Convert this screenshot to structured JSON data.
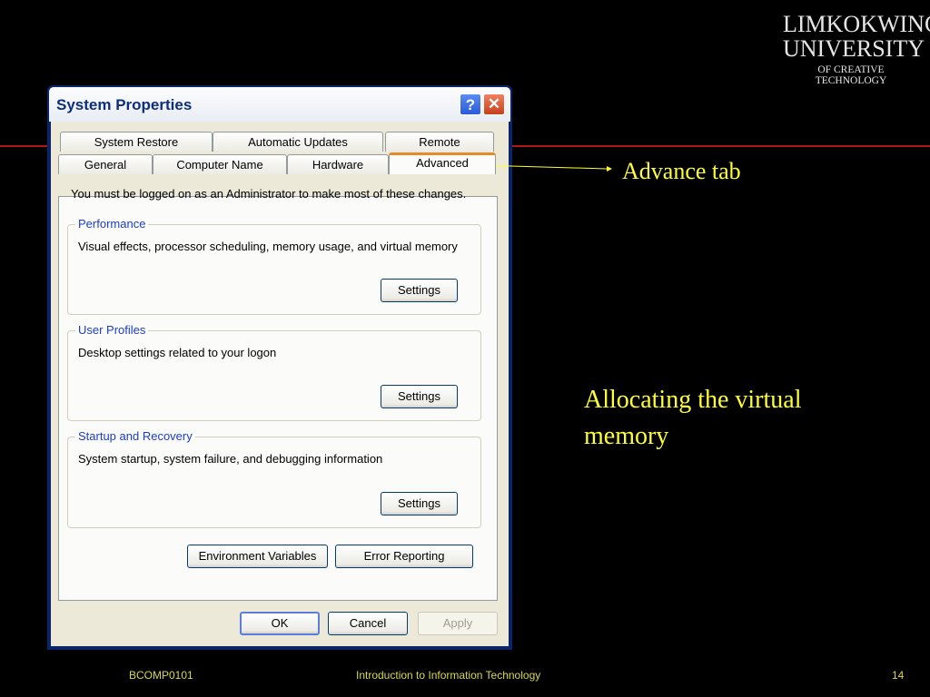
{
  "logo": {
    "line1": "LIMKOKWING",
    "line2": "UNIVERSITY",
    "line3": "OF CREATIVE TECHNOLOGY"
  },
  "dialog": {
    "title": "System Properties",
    "help_glyph": "?",
    "close_glyph": "✕",
    "tabs_row1": [
      "System Restore",
      "Automatic Updates",
      "Remote"
    ],
    "tabs_row2": [
      "General",
      "Computer Name",
      "Hardware",
      "Advanced"
    ],
    "active_tab": "Advanced",
    "note": "You must be logged on as an Administrator to make most of these changes.",
    "groups": [
      {
        "title": "Performance",
        "description": "Visual effects, processor scheduling, memory usage, and virtual memory",
        "button": "Settings"
      },
      {
        "title": "User Profiles",
        "description": "Desktop settings related to your logon",
        "button": "Settings"
      },
      {
        "title": "Startup and Recovery",
        "description": "System startup, system failure, and debugging information",
        "button": "Settings"
      }
    ],
    "env_button": "Environment Variables",
    "error_button": "Error Reporting",
    "ok_button": "OK",
    "cancel_button": "Cancel",
    "apply_button": "Apply"
  },
  "annotations": {
    "advance_tab": "Advance tab",
    "allocating": "Allocating the virtual memory"
  },
  "footer": {
    "course_code": "BCOMP0101",
    "course_title": "Introduction to Information Technology",
    "page_number": "14"
  },
  "colors": {
    "background": "#000000",
    "accent_line": "#b01818",
    "annotation_text": "#ffff33",
    "footer_text": "#d8d84a"
  }
}
